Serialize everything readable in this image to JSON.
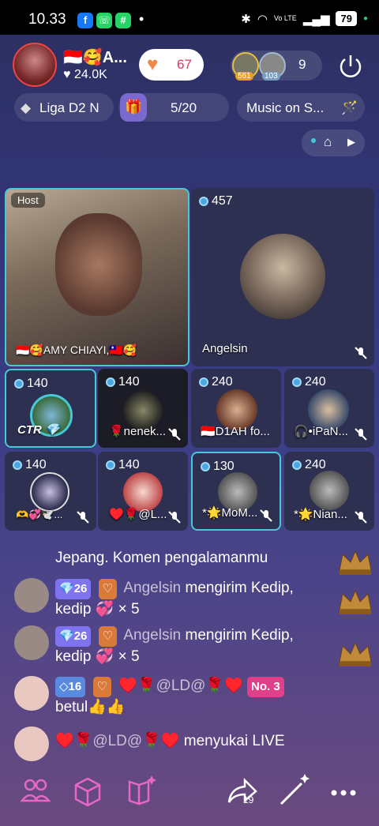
{
  "status_bar": {
    "time": "10.33",
    "apps": [
      "f",
      "☏",
      "#"
    ],
    "dot": "•",
    "signal_label": "Vo LTE",
    "battery": "79"
  },
  "host": {
    "name": "🇮🇩🥰A...",
    "likes": "♥ 24.0K",
    "follow_count": "67"
  },
  "viewers": {
    "badges": [
      "561",
      "103"
    ],
    "count": "9"
  },
  "badges": {
    "league": "Liga D2 N",
    "progress": "5/20",
    "music": "Music on S..."
  },
  "tiles": [
    {
      "label": "🇮🇩🥰AMY CHIAYI,🇹🇼🥰",
      "tag": "Host",
      "score": ""
    },
    {
      "label": "Angelsin",
      "score": "457"
    },
    {
      "label": "CTR 💎",
      "score": "140"
    },
    {
      "label": "🌹nenek...",
      "score": "140"
    },
    {
      "label": "🇮🇩D1AH fo...",
      "score": "240"
    },
    {
      "label": "🎧•iPaN...",
      "score": "240"
    },
    {
      "label": "🫶💞🕊️...",
      "score": "140"
    },
    {
      "label": "♥️🌹@L...",
      "score": "140"
    },
    {
      "label": "*🌟MoM...",
      "score": "130"
    },
    {
      "label": "*🌟Nian...",
      "score": "240"
    }
  ],
  "chat": {
    "pinned": "Jepang. Komen pengalamanmu",
    "messages": [
      {
        "level": "26",
        "user": "Angelsin",
        "text": "mengirim Kedip,",
        "line2": "kedip 💞 × 5"
      },
      {
        "level": "26",
        "user": "Angelsin",
        "text": "mengirim Kedip,",
        "line2": "kedip 💞 × 5"
      },
      {
        "level": "16",
        "user": "♥️🌹@LD@🌹♥️",
        "rank": "No. 3",
        "line2": "betul👍👍"
      },
      {
        "user": "♥️🌹@LD@🌹♥️",
        "text": "menyukai LIVE"
      }
    ]
  },
  "bottom": {
    "share_count": "19"
  },
  "colors": {
    "accent_cyan": "#46c9d6",
    "follow_red": "#e6335a",
    "level_blue": "#7f74f0",
    "rank_pink": "#e0408a"
  }
}
